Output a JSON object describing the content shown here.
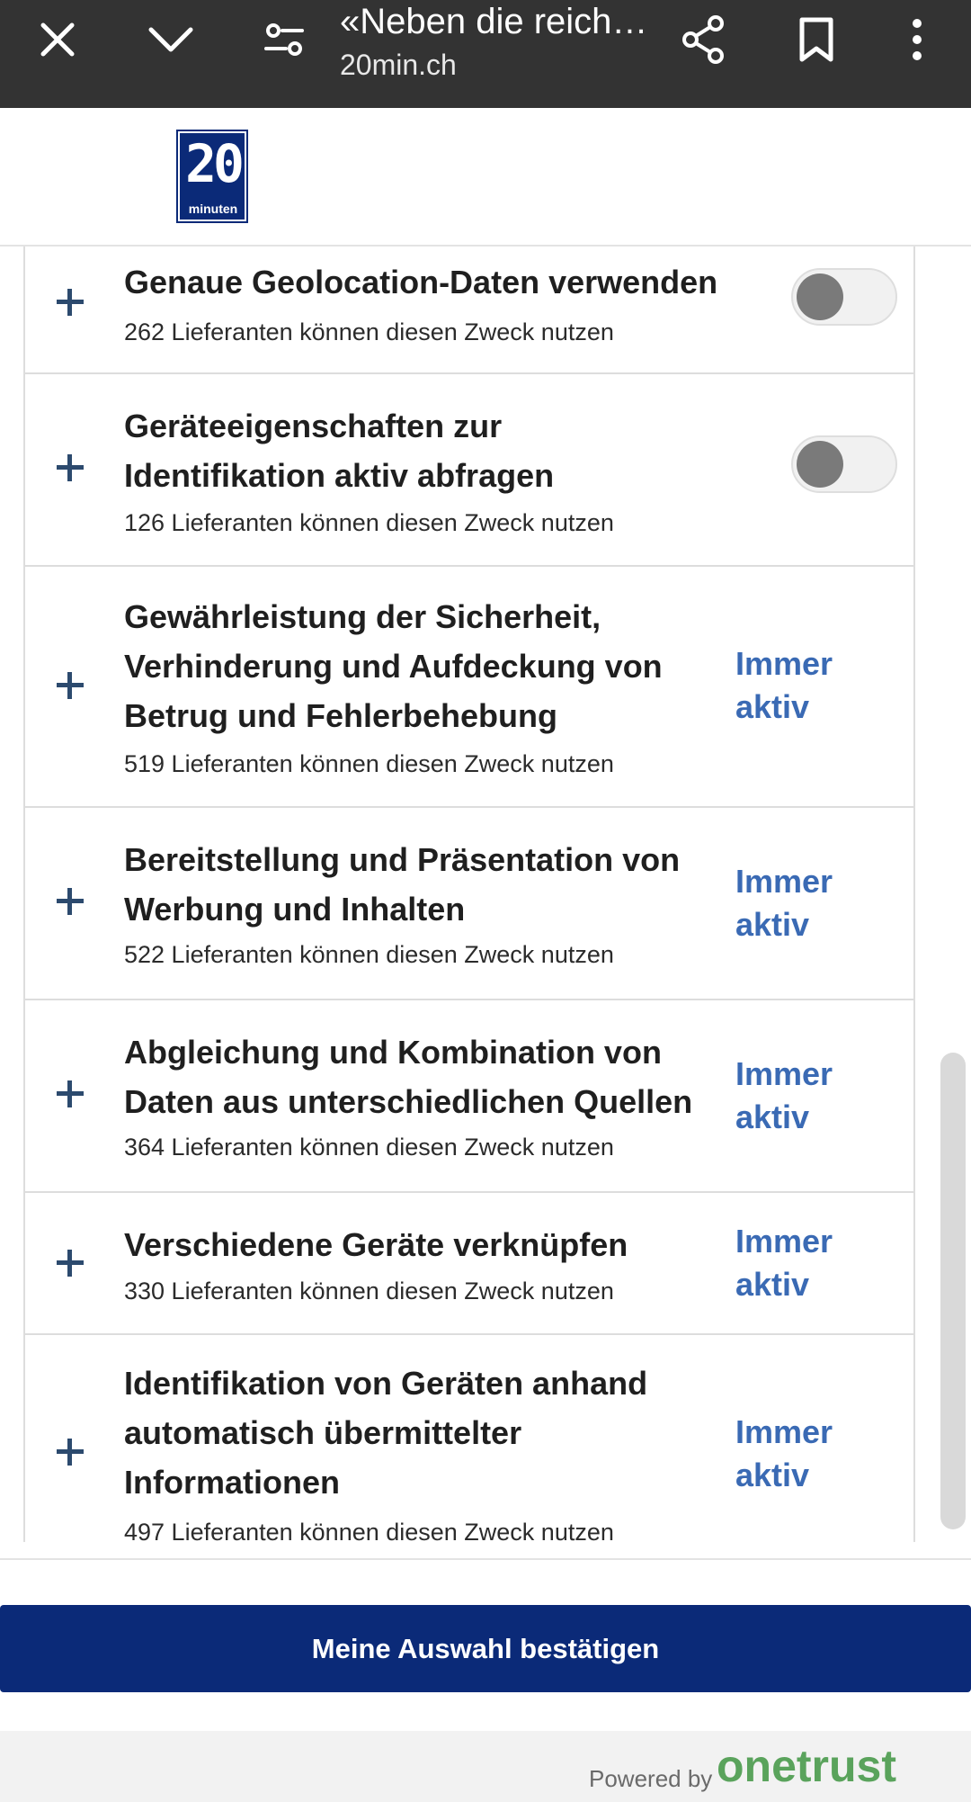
{
  "topbar": {
    "title": "«Neben die reich…",
    "subtitle": "20min.ch",
    "icons": [
      "close-icon",
      "chevron-down-icon",
      "tune-icon",
      "share-icon",
      "bookmark-icon",
      "more-vert-icon"
    ]
  },
  "logo": {
    "number": "20",
    "word": "minuten"
  },
  "purposes": [
    {
      "title": "Genaue Geolocation-Daten verwenden",
      "vendors": "262 Lieferanten können diesen Zweck nutzen",
      "control": "toggle",
      "enabled": false
    },
    {
      "title": "Geräteeigenschaften zur Identifikation aktiv abfragen",
      "vendors": "126 Lieferanten können diesen Zweck nutzen",
      "control": "toggle",
      "enabled": false
    },
    {
      "title": "Gewährleistung der Sicherheit, Verhinderung und Aufdeckung von Betrug und Fehlerbehebung",
      "vendors": "519 Lieferanten können diesen Zweck nutzen",
      "control": "always",
      "status": "Immer aktiv"
    },
    {
      "title": "Bereitstellung und Präsentation von Werbung und Inhalten",
      "vendors": "522 Lieferanten können diesen Zweck nutzen",
      "control": "always",
      "status": "Immer aktiv"
    },
    {
      "title": "Abgleichung und Kombination von Daten aus unterschiedlichen Quellen",
      "vendors": "364 Lieferanten können diesen Zweck nutzen",
      "control": "always",
      "status": "Immer aktiv"
    },
    {
      "title": "Verschiedene Geräte verknüpfen",
      "vendors": "330 Lieferanten können diesen Zweck nutzen",
      "control": "always",
      "status": "Immer aktiv"
    },
    {
      "title": "Identifikation von Geräten anhand automatisch übermittelter Informationen",
      "vendors": "497 Lieferanten können diesen Zweck nutzen",
      "control": "always",
      "status": "Immer aktiv"
    }
  ],
  "confirm_label": "Meine Auswahl bestätigen",
  "footer": {
    "powered_by": "Powered by",
    "brand": "onetrust"
  },
  "colors": {
    "brand_blue": "#0b2a78",
    "link_blue": "#3a6ab4",
    "onetrust_green": "#5aa35c"
  }
}
